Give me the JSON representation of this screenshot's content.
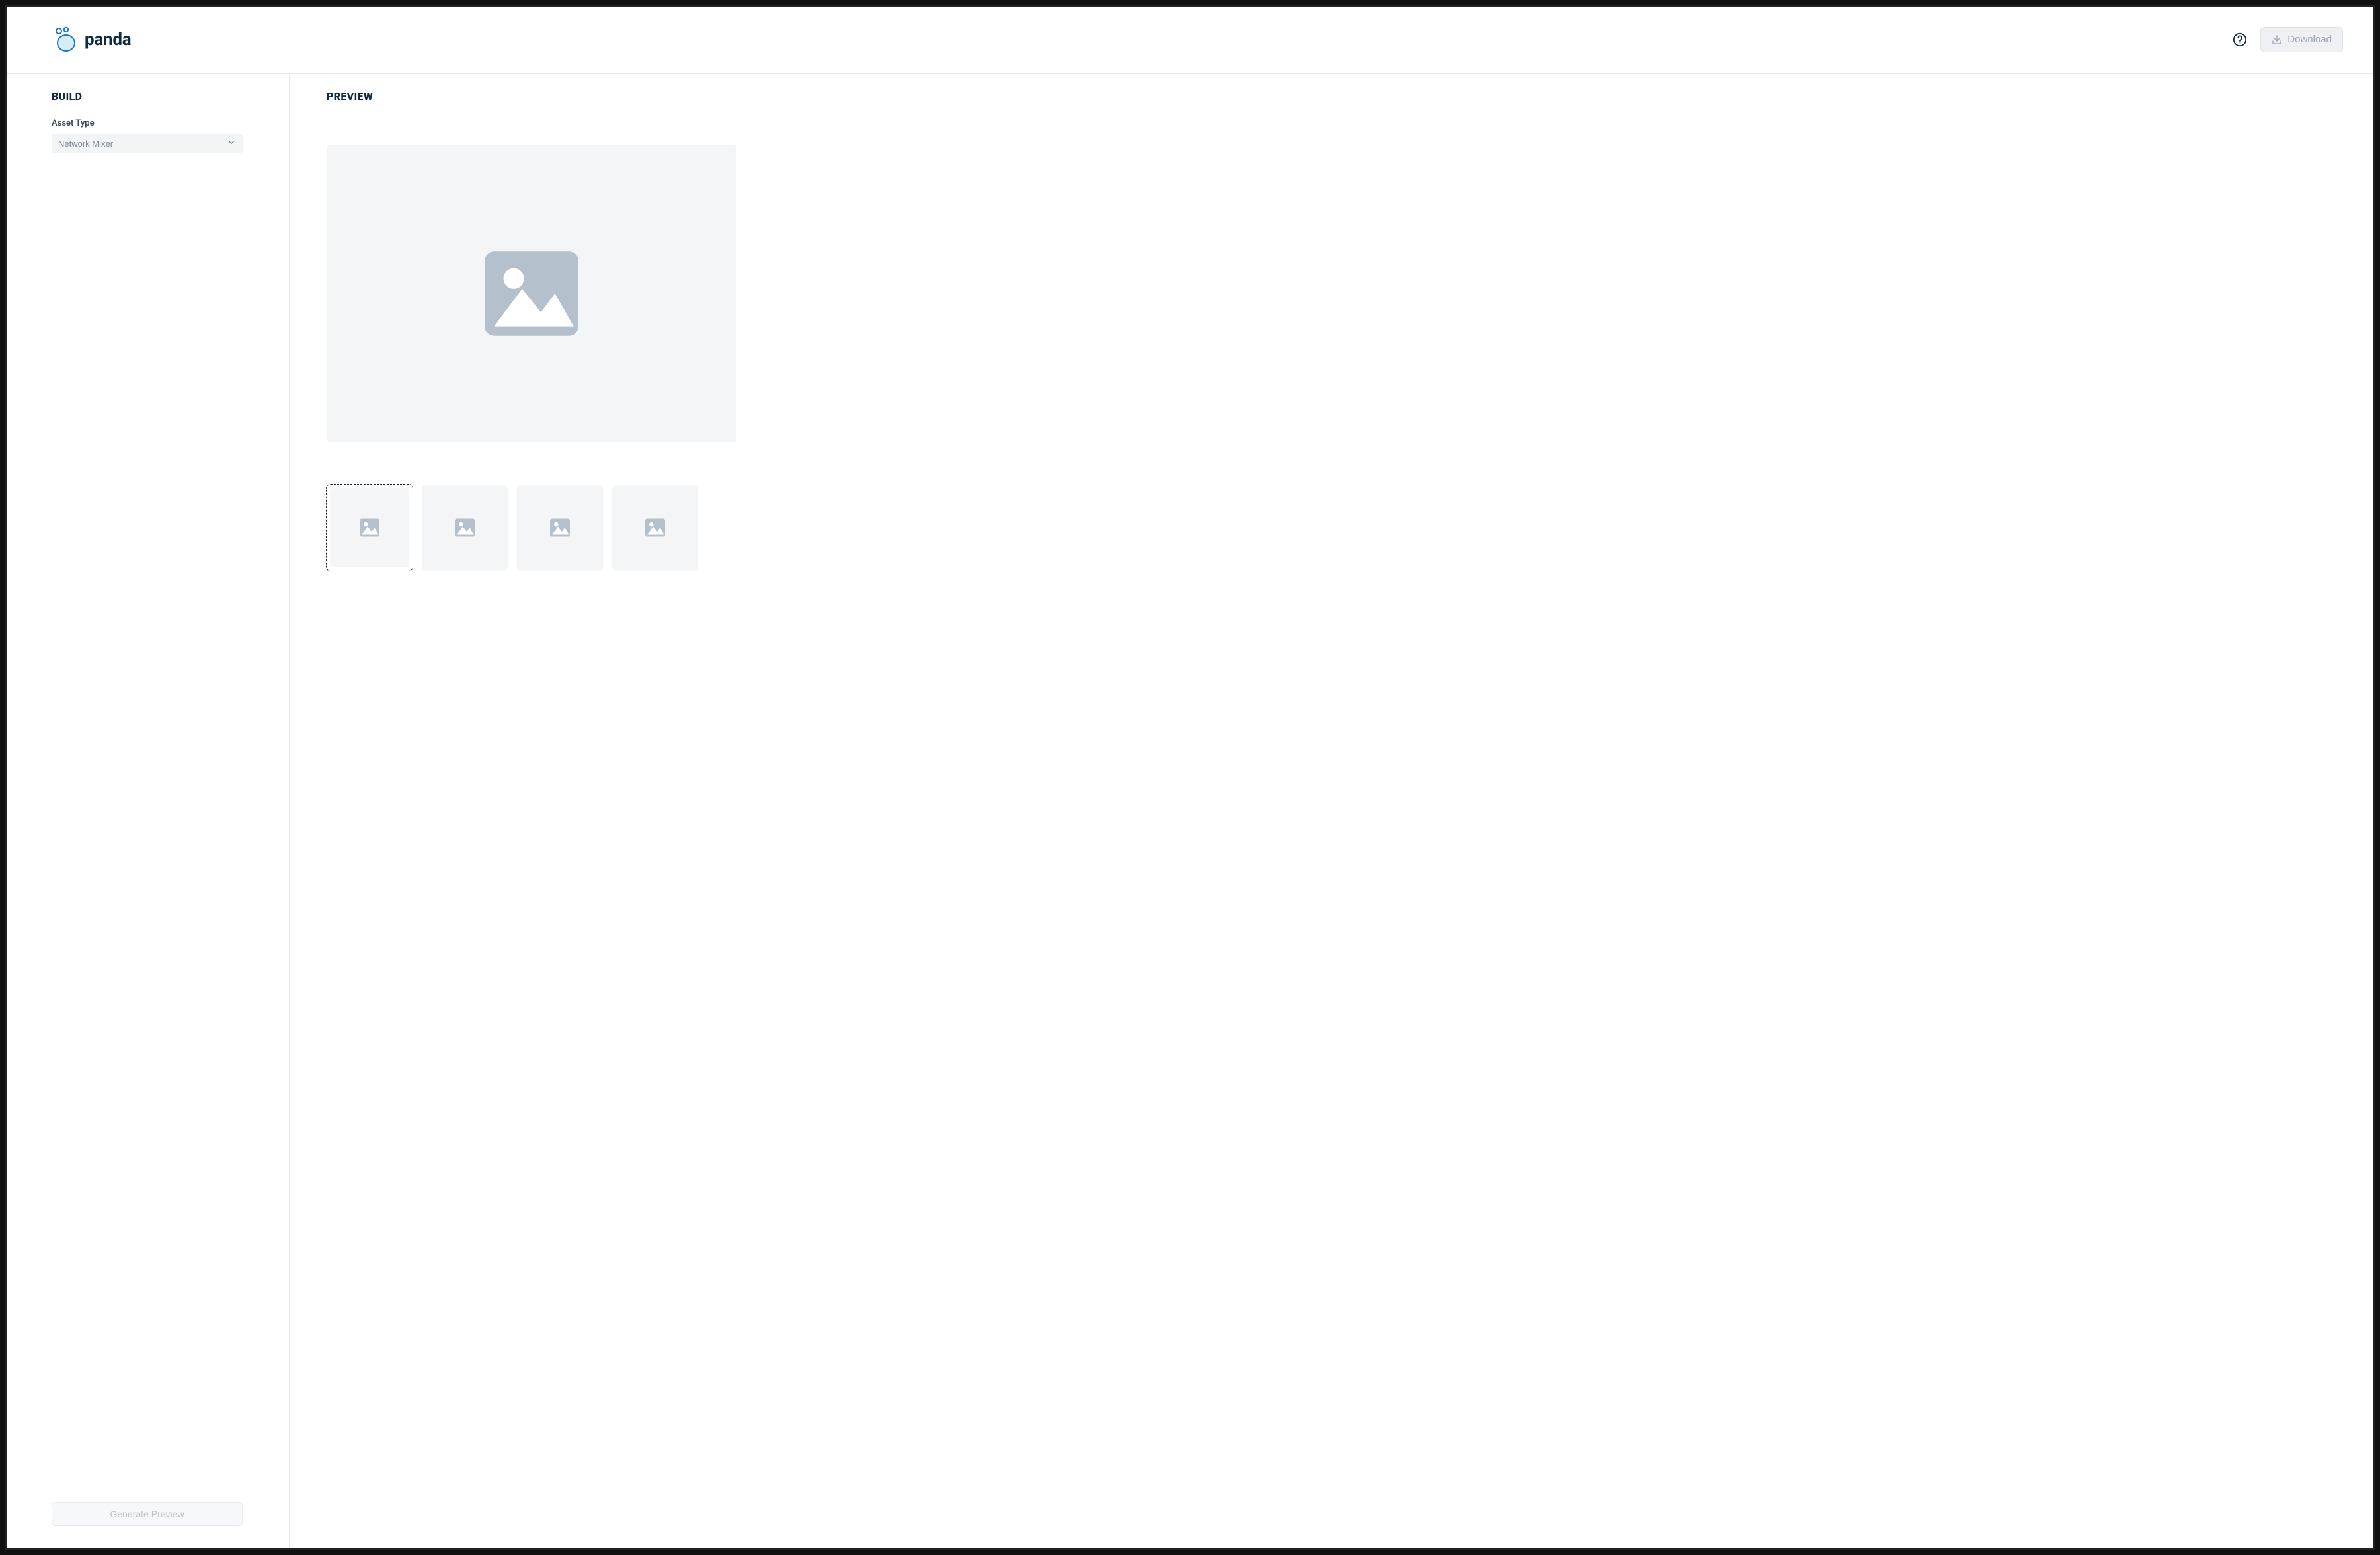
{
  "header": {
    "logo_text": "panda",
    "download_label": "Download"
  },
  "build": {
    "title": "BUILD",
    "asset_type_label": "Asset Type",
    "asset_type_value": "Network Mixer",
    "generate_label": "Generate Preview"
  },
  "preview": {
    "title": "PREVIEW",
    "thumbs": [
      {
        "selected": true
      },
      {
        "selected": false
      },
      {
        "selected": false
      },
      {
        "selected": false
      }
    ]
  },
  "icons": {
    "help": "help-circle",
    "download": "download",
    "chevron_down": "chevron-down",
    "image_placeholder": "image"
  }
}
